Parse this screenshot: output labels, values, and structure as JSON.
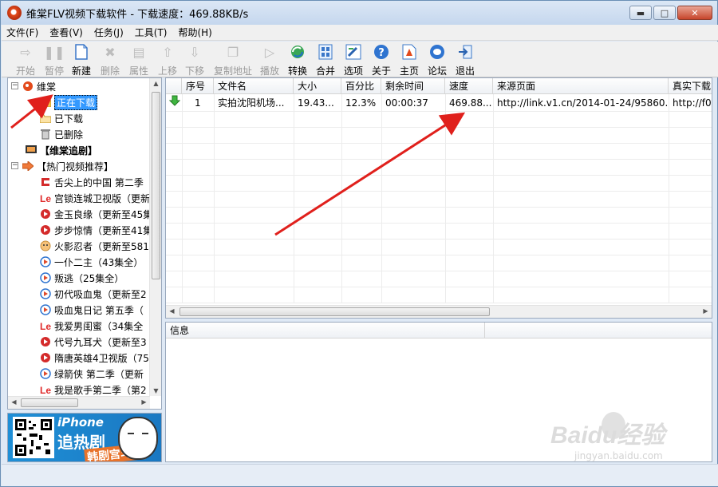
{
  "window": {
    "title": "维棠FLV视频下载软件 - 下载速度：469.88KB/s"
  },
  "window_buttons": {
    "minimize": "▬",
    "maximize": "□",
    "close": "✕"
  },
  "menu": [
    "文件(F)",
    "查看(V)",
    "任务(J)",
    "工具(T)",
    "帮助(H)"
  ],
  "toolbar": [
    {
      "label": "开始",
      "icon": "play-outline-icon",
      "enabled": false
    },
    {
      "label": "暂停",
      "icon": "pause-icon",
      "enabled": false
    },
    {
      "label": "新建",
      "icon": "new-document-icon",
      "enabled": true
    },
    {
      "label": "删除",
      "icon": "delete-icon",
      "enabled": false
    },
    {
      "label": "属性",
      "icon": "properties-icon",
      "enabled": false
    },
    {
      "label": "上移",
      "icon": "move-up-icon",
      "enabled": false
    },
    {
      "label": "下移",
      "icon": "move-down-icon",
      "enabled": false
    },
    {
      "label": "复制地址",
      "icon": "copy-address-icon",
      "enabled": false
    },
    {
      "label": "播放",
      "icon": "play-icon",
      "enabled": false
    },
    {
      "label": "转换",
      "icon": "convert-icon",
      "enabled": true
    },
    {
      "label": "合并",
      "icon": "merge-icon",
      "enabled": true
    },
    {
      "label": "选项",
      "icon": "options-icon",
      "enabled": true
    },
    {
      "label": "关于",
      "icon": "help-icon",
      "enabled": true
    },
    {
      "label": "主页",
      "icon": "homepage-icon",
      "enabled": true
    },
    {
      "label": "论坛",
      "icon": "forum-icon",
      "enabled": true
    },
    {
      "label": "退出",
      "icon": "exit-icon",
      "enabled": true
    }
  ],
  "tree": {
    "root": "维棠",
    "root_children": [
      "正在下载",
      "已下载",
      "已删除"
    ],
    "drama": "【维棠追剧】",
    "hot": "【热门视频推荐】",
    "hot_items": [
      {
        "label": "舌尖上的中国 第二季",
        "icon": "cntv-logo-icon"
      },
      {
        "label": "宫锁连城卫视版（更新",
        "icon": "letv-logo-icon"
      },
      {
        "label": "金玉良缘（更新至45集",
        "icon": "red-play-icon"
      },
      {
        "label": "步步惊情（更新至41集",
        "icon": "red-play-icon"
      },
      {
        "label": "火影忍者（更新至581",
        "icon": "naruto-icon"
      },
      {
        "label": "一仆二主（43集全）",
        "icon": "blue-play-icon"
      },
      {
        "label": "叛逃（25集全）",
        "icon": "blue-play-icon"
      },
      {
        "label": "初代吸血鬼（更新至2",
        "icon": "blue-play-icon"
      },
      {
        "label": "吸血鬼日记 第五季（",
        "icon": "blue-play-icon"
      },
      {
        "label": "我爱男闺蜜（34集全",
        "icon": "letv-logo-icon"
      },
      {
        "label": "代号九耳犬（更新至3",
        "icon": "red-play-icon"
      },
      {
        "label": "隋唐英雄4卫视版（75",
        "icon": "red-play-icon"
      },
      {
        "label": "绿箭侠 第二季（更新",
        "icon": "blue-play-icon"
      },
      {
        "label": "我是歌手第二季（第2",
        "icon": "letv-logo-icon"
      }
    ]
  },
  "banner": {
    "line1": "iPhone",
    "line2": "追热剧",
    "line3": "韩剧宫斗剧"
  },
  "list": {
    "columns": [
      "",
      "序号",
      "文件名",
      "大小",
      "百分比",
      "剩余时间",
      "速度",
      "来源页面",
      "真实下载"
    ],
    "rows": [
      {
        "status_icon": "download-arrow-icon",
        "no": "1",
        "name": "实拍沈阳机场...",
        "size": "19.43...",
        "percent": "12.3%",
        "remaining": "00:00:37",
        "speed": "469.88...",
        "source": "http://link.v1.cn/2014-01-24/95860...",
        "real": "http://f0"
      }
    ]
  },
  "info": {
    "header": "信息"
  },
  "watermark": {
    "line1": "Baidu经验",
    "line2": "jingyan.baidu.com"
  },
  "colors": {
    "annotation_arrow": "#e0201c",
    "selection": "#3399ff"
  }
}
